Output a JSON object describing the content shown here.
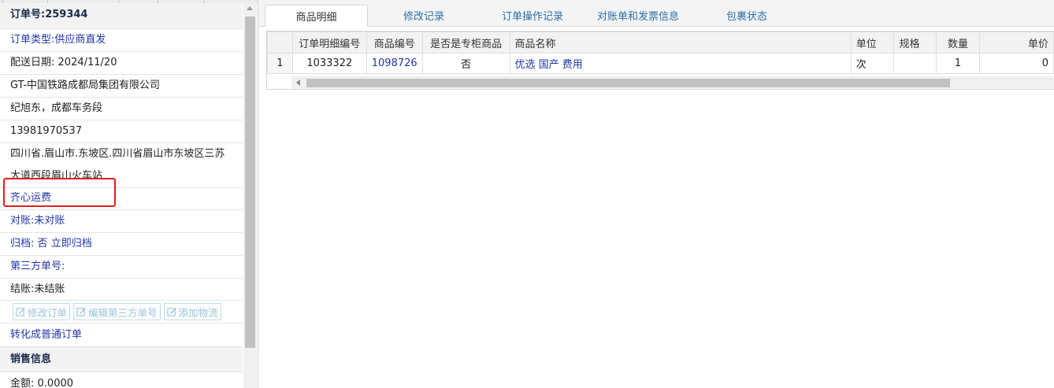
{
  "order_panel": {
    "order_no_label": "订单号:",
    "order_no": "259344",
    "order_type_label": "订单类型:",
    "order_type": "供应商直发",
    "delivery_date_label": "配送日期:",
    "delivery_date": "2024/11/20",
    "company": "GT-中国铁路成都局集团有限公司",
    "contact": "纪旭东，成都车务段",
    "phone": "13981970537",
    "address_line1": "四川省.眉山市.东坡区.四川省眉山市东坡区三苏",
    "address_line2": "大道西段眉山火车站",
    "freight": "齐心运费",
    "reconcile_label": "对账:",
    "reconcile_value": "未对账",
    "archive_label": "归档:",
    "archive_value": "否",
    "archive_link": "立即归档",
    "third_party_label": "第三方单号:",
    "settle_label": "结账:",
    "settle_value": "未结账",
    "btn_edit_order": "修改订单",
    "btn_edit_third": "编辑第三方单号",
    "btn_add_logistics": "添加物流",
    "convert_link": "转化成普通订单",
    "sales_header": "销售信息",
    "amount_label": "金额:",
    "amount_value": "0.0000"
  },
  "tabs": [
    "商品明细",
    "修改记录",
    "订单操作记录",
    "对账单和发票信息",
    "包裹状态"
  ],
  "grid": {
    "columns": [
      "订单明细编号",
      "商品编号",
      "是否是专柜商品",
      "商品名称",
      "单位",
      "规格",
      "数量",
      "单价"
    ],
    "rows": [
      {
        "index": "1",
        "detail_no": "1033322",
        "product_no": "1098726",
        "is_counter": "否",
        "name": "优选 国产 费用",
        "unit": "次",
        "spec": "",
        "qty": "1",
        "price": "0"
      }
    ]
  },
  "colors": {
    "link": "#2136a8",
    "tab_text": "#2a6fa8",
    "highlight_box": "#e02020"
  }
}
